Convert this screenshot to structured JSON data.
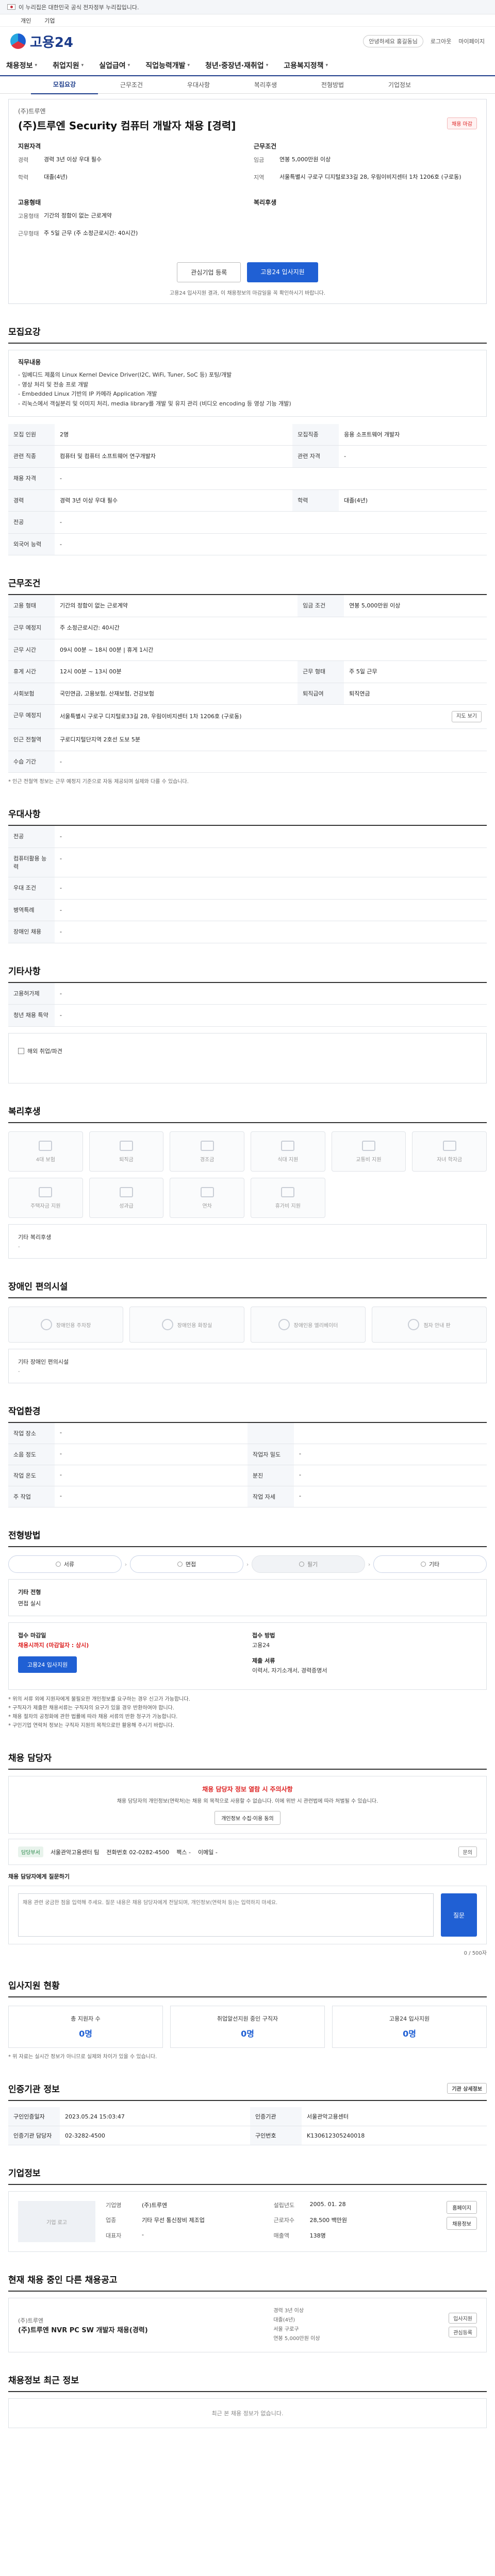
{
  "govbar": {
    "text": "이 누리집은 대한민국 공식 전자정부 누리집입니다."
  },
  "topbar": {
    "links": [
      "개인",
      "기업"
    ]
  },
  "header": {
    "logo": "고용24",
    "right": [
      "안녕하세요 홍길동님",
      "로그아웃",
      "마이페이지"
    ]
  },
  "gnb": {
    "items": [
      "채용정보",
      "취업지원",
      "실업급여",
      "직업능력개발",
      "청년·중장년·재취업",
      "고용복지정책"
    ]
  },
  "subtabs": {
    "items": [
      "모집요강",
      "근무조건",
      "우대사항",
      "복리후생",
      "전형방법",
      "기업정보"
    ],
    "active": 0
  },
  "job": {
    "company": "(주)트루엔",
    "title": "(주)트루엔 Security 컴퓨터 개발자 채용 [경력]",
    "badge": "채용 마감",
    "left_title": "지원자격",
    "left": [
      {
        "k": "경력",
        "v": "경력 3년 이상 우대 필수"
      },
      {
        "k": "학력",
        "v": "대졸(4년)"
      }
    ],
    "left2_title": "고용형태",
    "left2": [
      {
        "k": "고용형태",
        "v": "기간의 정함이 없는 근로계약"
      },
      {
        "k": "근무형태",
        "v": "주 5일 근무 (주 소정근로시간: 40시간)"
      }
    ],
    "right_title": "근무조건",
    "right": [
      {
        "k": "임금",
        "v": "연봉 5,000만원 이상"
      },
      {
        "k": "지역",
        "v": "서울특별시 구로구 디지털로33길 28, 우림이비지센터 1차 1206호 (구로동)"
      }
    ],
    "right2_title": "복리후생",
    "btn_interest": "관심기업 등록",
    "btn_apply": "고용24 입사지원",
    "note": "고용24 입사지원 결과, 이 채용정보의 마감일을 꼭 확인하시기 바랍니다."
  },
  "recruit": {
    "title": "모집요강",
    "duty_label": "직무내용",
    "duty": [
      "- 임베디드 제품의 Linux Kernel Device Driver(I2C, WiFi, Tuner, SoC 등) 포팅/개발",
      "- 영상 처리 및 전송 프로 개발",
      "- Embedded Linux 기반의 IP 카메라 Application 개발",
      "- 리눅스에서 객실분리 및 이미지 처리, media library를 개발 및 유지 관리 (비디오 encoding 등 영상 기능 개발)"
    ],
    "rows": [
      {
        "k": "모집 인원",
        "v": "2명",
        "k2": "모집직종",
        "v2": "응용 소프트웨어 개발자"
      },
      {
        "k": "관련 직종",
        "v": "컴퓨터 및 컴퓨터 소프트웨어 연구개발자",
        "k2": "관련 자격",
        "v2": "-"
      },
      {
        "k": "채용 자격",
        "v": "-",
        "k2": "",
        "v2": ""
      },
      {
        "k": "경력",
        "v": "경력 3년 이상 우대 필수",
        "k2": "학력",
        "v2": "대졸(4년)"
      },
      {
        "k": "전공",
        "v": "-",
        "k2": "",
        "v2": ""
      },
      {
        "k": "외국어 능력",
        "v": "-",
        "k2": "",
        "v2": ""
      }
    ]
  },
  "work": {
    "title": "근무조건",
    "rows": [
      {
        "k": "고용 형태",
        "v": "기간의 정함이 없는 근로계약",
        "k2": "임금 조건",
        "v2": "연봉 5,000만원 이상"
      },
      {
        "k": "근무 예정지",
        "v": "주 소정근로시간: 40시간",
        "k2": "",
        "v2": ""
      },
      {
        "k": "근무 시간",
        "v": "09시 00분 ~ 18시 00분  |  휴게 1시간",
        "k2": "",
        "v2": ""
      },
      {
        "k": "휴게 시간",
        "v": "12시 00분 ~ 13시 00분",
        "k2": "근무 형태",
        "v2": "주 5일 근무"
      },
      {
        "k": "사회보험",
        "v": "국민연금, 고용보험, 산재보험, 건강보험",
        "k2": "퇴직급여",
        "v2": "퇴직연금"
      },
      {
        "k": "근무 예정지",
        "v": "서울특별시 구로구 디지털로33길 28, 우림이비지센터 1차 1206호 (구로동)",
        "k2": "",
        "v2": ""
      },
      {
        "k": "인근 전철역",
        "v": "구로디지털단지역 2호선 도보 5분",
        "k2": "",
        "v2": ""
      },
      {
        "k": "수습 기간",
        "v": "-",
        "k2": "",
        "v2": ""
      }
    ],
    "map_btn": "지도 보기",
    "note": "* 인근 전철역 정보는 근무 예정지 기준으로 자동 제공되며 실제와 다를 수 있습니다."
  },
  "prefer": {
    "title": "우대사항",
    "rows": [
      {
        "k": "전공",
        "v": "-"
      },
      {
        "k": "컴퓨터활용 능력",
        "v": "-"
      },
      {
        "k": "우대 조건",
        "v": "-"
      },
      {
        "k": "병역특례",
        "v": "-"
      },
      {
        "k": "장애인 채용",
        "v": "-"
      }
    ]
  },
  "etc": {
    "title": "기타사항",
    "rows": [
      {
        "k": "고용허가제",
        "v": "-"
      },
      {
        "k": "청년 채용 특약",
        "v": "-"
      }
    ],
    "check": "해외 취업/파견"
  },
  "benefits": {
    "title": "복리후생",
    "items": [
      "4대 보험",
      "퇴직금",
      "경조금",
      "식대 지원",
      "교통비 지원",
      "자녀 학자금",
      "주택자금 지원",
      "성과급",
      "연차",
      "휴가비 지원"
    ],
    "empty": "기타 복리후생",
    "empty_sub": "-"
  },
  "facility": {
    "title": "장애인 편의시설",
    "items": [
      "장애인용 주차장",
      "장애인용 화장실",
      "장애인용 엘리베이터",
      "점자 안내 판"
    ],
    "empty": "기타 장애인 편의시설",
    "empty_sub": "-"
  },
  "env": {
    "title": "작업환경",
    "rows": [
      {
        "k": "작업 장소",
        "v": "-",
        "k2": "",
        "v2": ""
      },
      {
        "k": "소음 정도",
        "v": "-",
        "k2": "작업자 밀도",
        "v2": "-"
      },
      {
        "k": "작업 온도",
        "v": "-",
        "k2": "분진",
        "v2": "-"
      },
      {
        "k": "주 작업",
        "v": "-",
        "k2": "작업 자세",
        "v2": "-"
      }
    ]
  },
  "process": {
    "title": "전형방법",
    "steps": [
      "서류",
      "면접",
      "필기",
      "기타"
    ],
    "box_k": "기타 전형",
    "box_v": "면접 실시",
    "apply_k1": "접수 마감일",
    "apply_v1": "채용시까지 (마감일자 : 상시)",
    "apply_k2": "접수 방법",
    "apply_v2": "고용24",
    "apply_k3": "제출 서류",
    "apply_v3": "이력서, 자기소개서, 경력증명서",
    "btn": "고용24 입사지원",
    "bullets": [
      "* 위의 서류 외에 지원자에게 불필요한 개인정보를 요구하는 경우 신고가 가능합니다.",
      "* 구직자가 제출한 채용서류는 구직자의 요구가 있을 경우 반환하여야 합니다.",
      "* 채용 절차의 공정화에 관한 법률에 따라 채용 서류의 반환 청구가 가능합니다.",
      "* 구인기업 연락처 정보는 구직자 지원의 목적으로만 활용해 주시기 바랍니다."
    ]
  },
  "contact": {
    "title": "채용 담당자",
    "alert_h": "채용 담당자 정보 열람 시 주의사항",
    "alert_p": "채용 담당자의 개인정보(연락처)는 채용 외 목적으로 사용할 수 없습니다. 이에 위반 시 관련법에 따라 처벌될 수 있습니다.",
    "alert_btn": "개인정보 수집·이용 동의",
    "label": "담당부서",
    "name": "서울관악고용센터 팀",
    "phone": "전화번호  02-0282-4500",
    "fax": "팩스  -",
    "email": "이메일  -",
    "btn": "문의",
    "q_title": "채용 담당자에게 질문하기",
    "q_placeholder": "채용 관련 궁금한 점을 입력해 주세요. 질문 내용은 채용 담당자에게 전달되며, 개인정보(연락처 등)는 입력하지 마세요.",
    "q_send": "질문",
    "q_count": "0 / 500자"
  },
  "stats": {
    "title": "입사지원 현황",
    "items": [
      {
        "k": "총 지원자 수",
        "v": "0명"
      },
      {
        "k": "취업알선지원 중인 구직자",
        "v": "0명"
      },
      {
        "k": "고용24 입사지원",
        "v": "0명"
      }
    ],
    "note": "* 위 자료는 실시간 정보가 아니므로 실제와 차이가 있을 수 있습니다."
  },
  "reg": {
    "title": "인증기관 정보",
    "btn": "기관 상세정보",
    "rows": [
      {
        "k": "구인인증일자",
        "v": "2023.05.24 15:03:47",
        "k2": "인증기관",
        "v2": "서울관악고용센터"
      },
      {
        "k": "인증기관 담당자",
        "v": "02-3282-4500",
        "k2": "구인번호",
        "v2": "K130612305240018"
      }
    ]
  },
  "corp": {
    "title": "기업정보",
    "logo": "기업 로고",
    "rows": [
      {
        "k": "기업명",
        "v": "(주)트루엔",
        "k2": "설립년도",
        "v2": "2005. 01. 28"
      },
      {
        "k": "업종",
        "v": "기타 무선 통신장비 제조업",
        "k2": "근로자수",
        "v2": "28,500 백만원"
      },
      {
        "k": "대표자",
        "v": "-",
        "k2": "매출액",
        "v2": "138명"
      }
    ],
    "side": [
      "홈페이지",
      "채용정보"
    ]
  },
  "same": {
    "title": "현재 채용 중인 다른 채용공고",
    "company": "(주)트루엔",
    "name": "(주)트루엔 NVR PC SW 개발자 채용(경력)",
    "meta": [
      "경력 3년 이상",
      "대졸(4년)",
      "서울 구로구",
      "연봉 5,000만원 이상"
    ],
    "btn": [
      "입사지원",
      "관심등록"
    ]
  },
  "recent": {
    "title": "채용정보 최근 정보",
    "empty": "최근 본 채용 정보가 없습니다."
  }
}
